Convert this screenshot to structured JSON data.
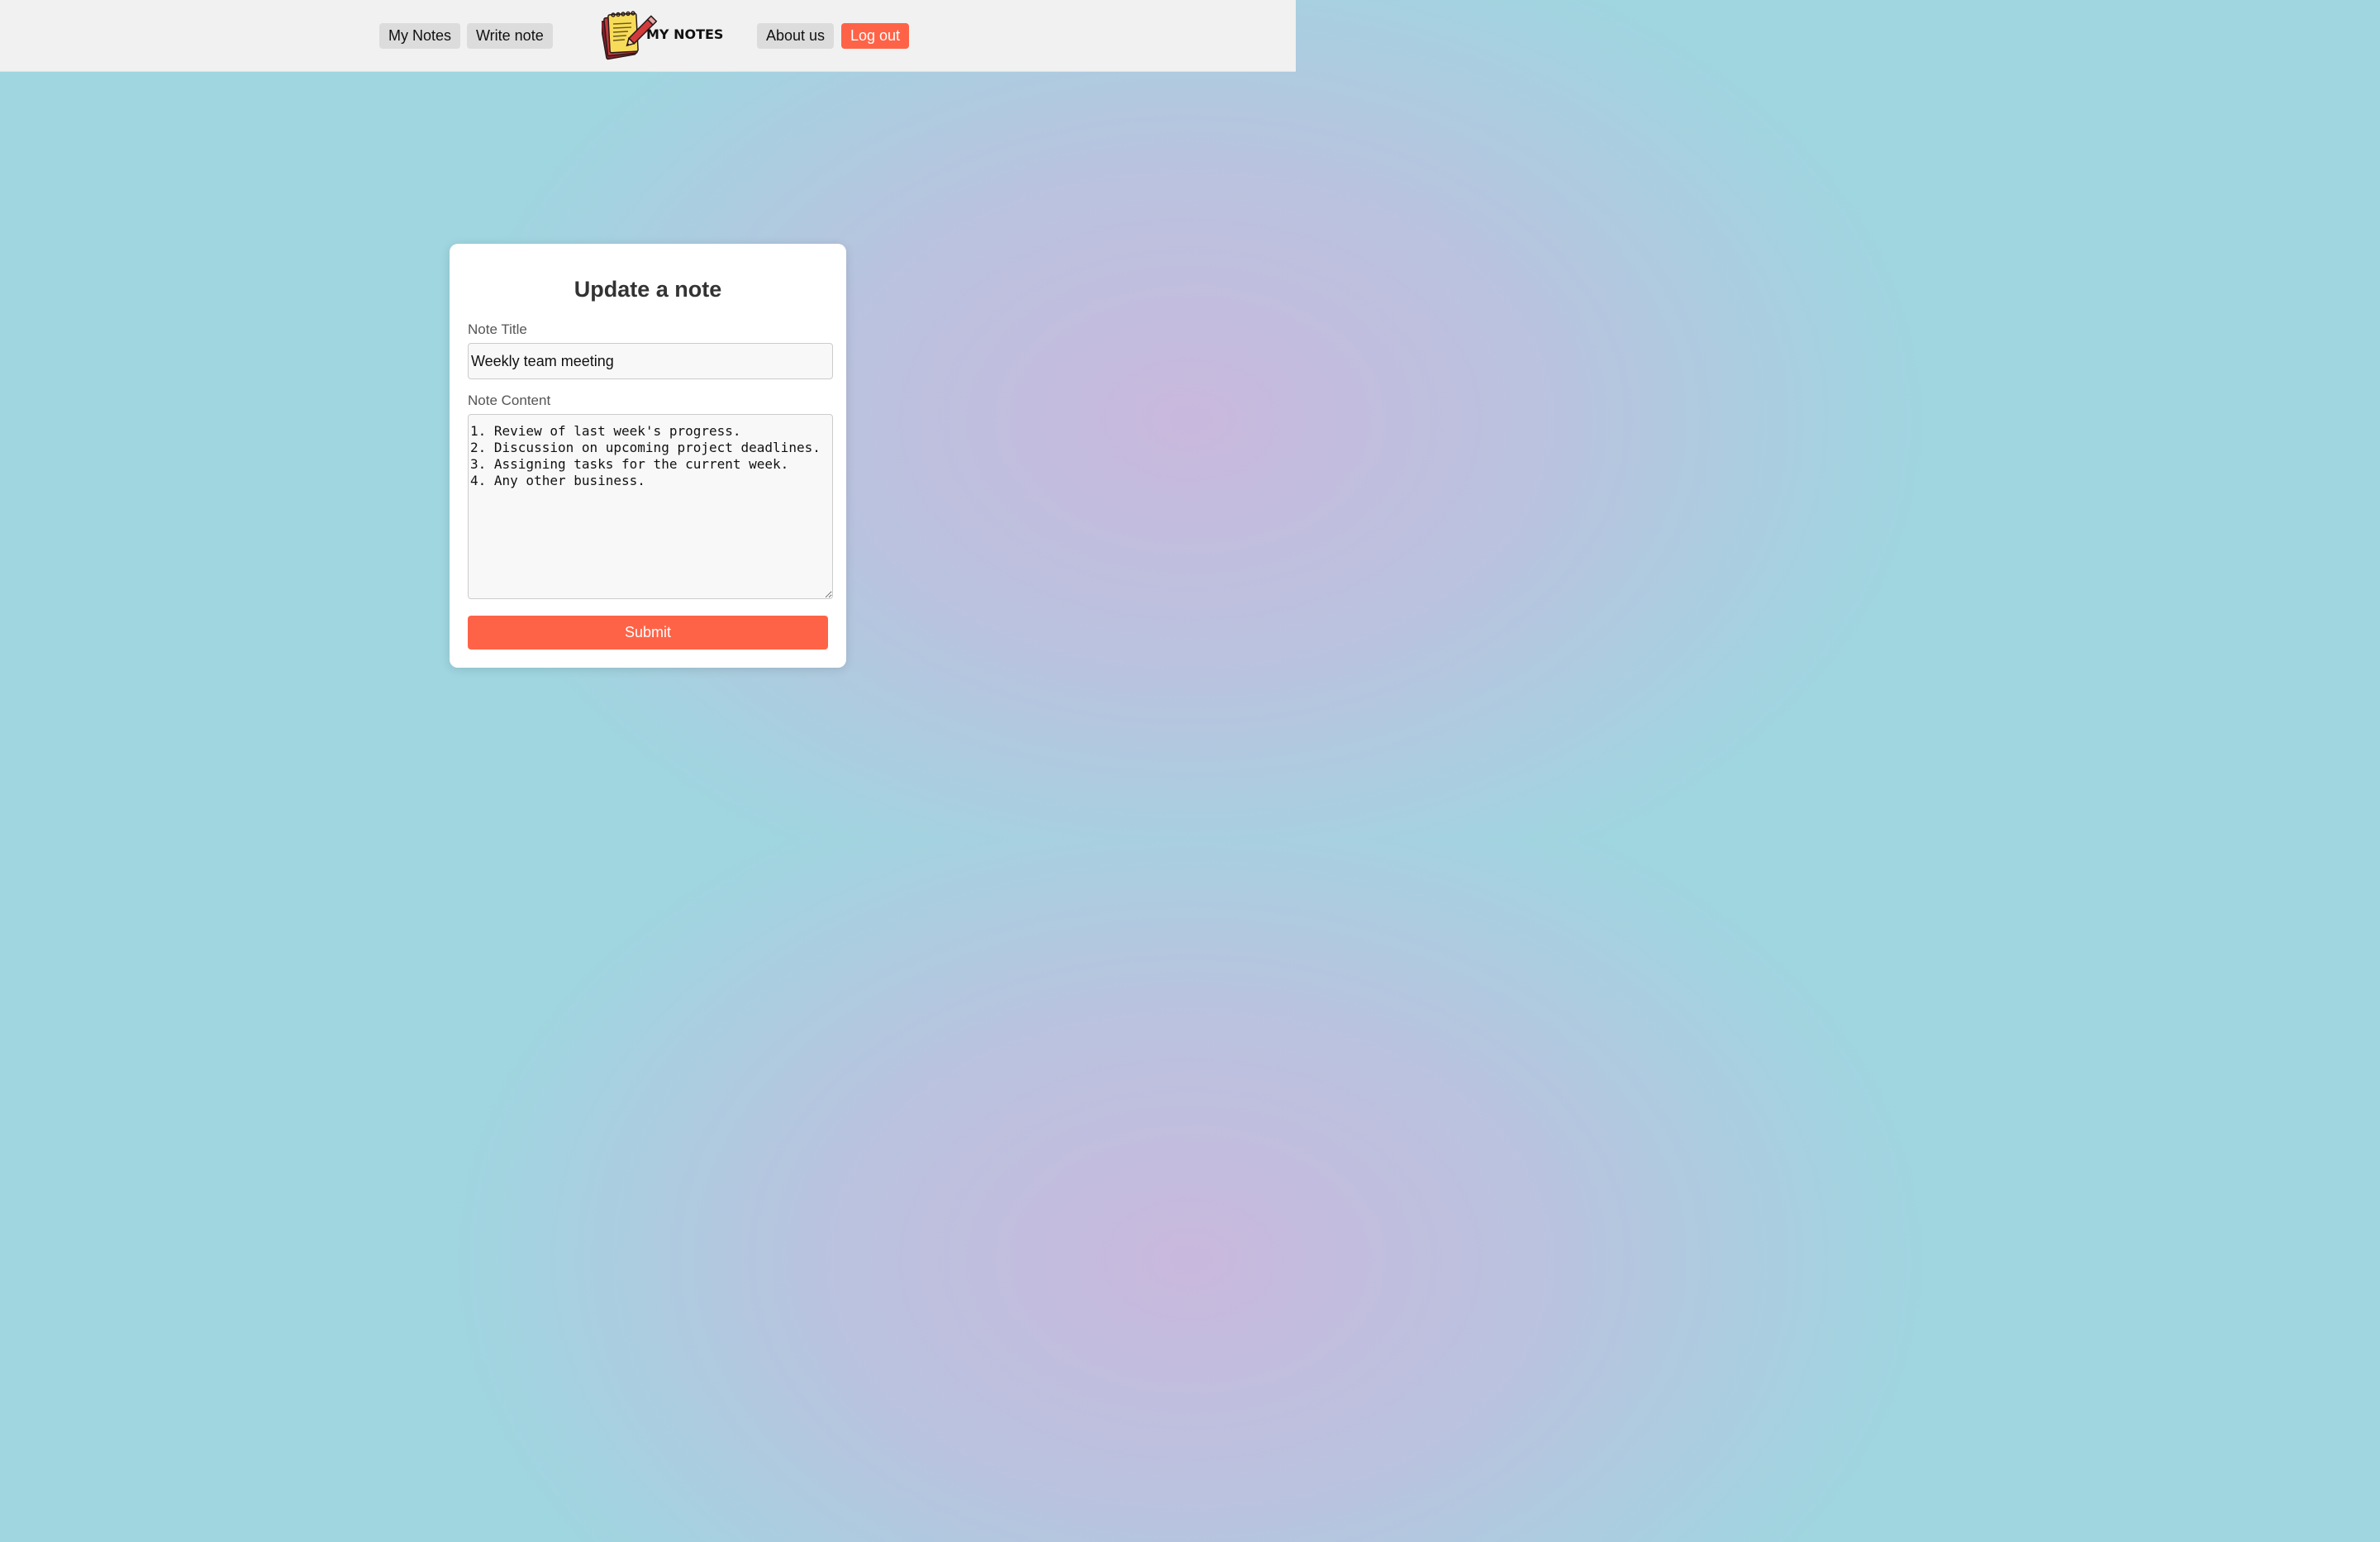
{
  "nav": {
    "my_notes_label": "My Notes",
    "write_note_label": "Write note",
    "brand": "MY NOTES",
    "about_label": "About us",
    "logout_label": "Log out"
  },
  "form": {
    "heading": "Update a note",
    "title_label": "Note Title",
    "title_value": "Weekly team meeting",
    "content_label": "Note Content",
    "content_value": "1. Review of last week's progress.\n2. Discussion on upcoming project deadlines.\n3. Assigning tasks for the current week.\n4. Any other business.",
    "submit_label": "Submit"
  },
  "colors": {
    "accent": "#ff6347",
    "nav_bg": "#f1f1f1",
    "nav_button_bg": "#dcdcdc"
  },
  "icons": {
    "logo": "notepad-pencil-icon"
  }
}
